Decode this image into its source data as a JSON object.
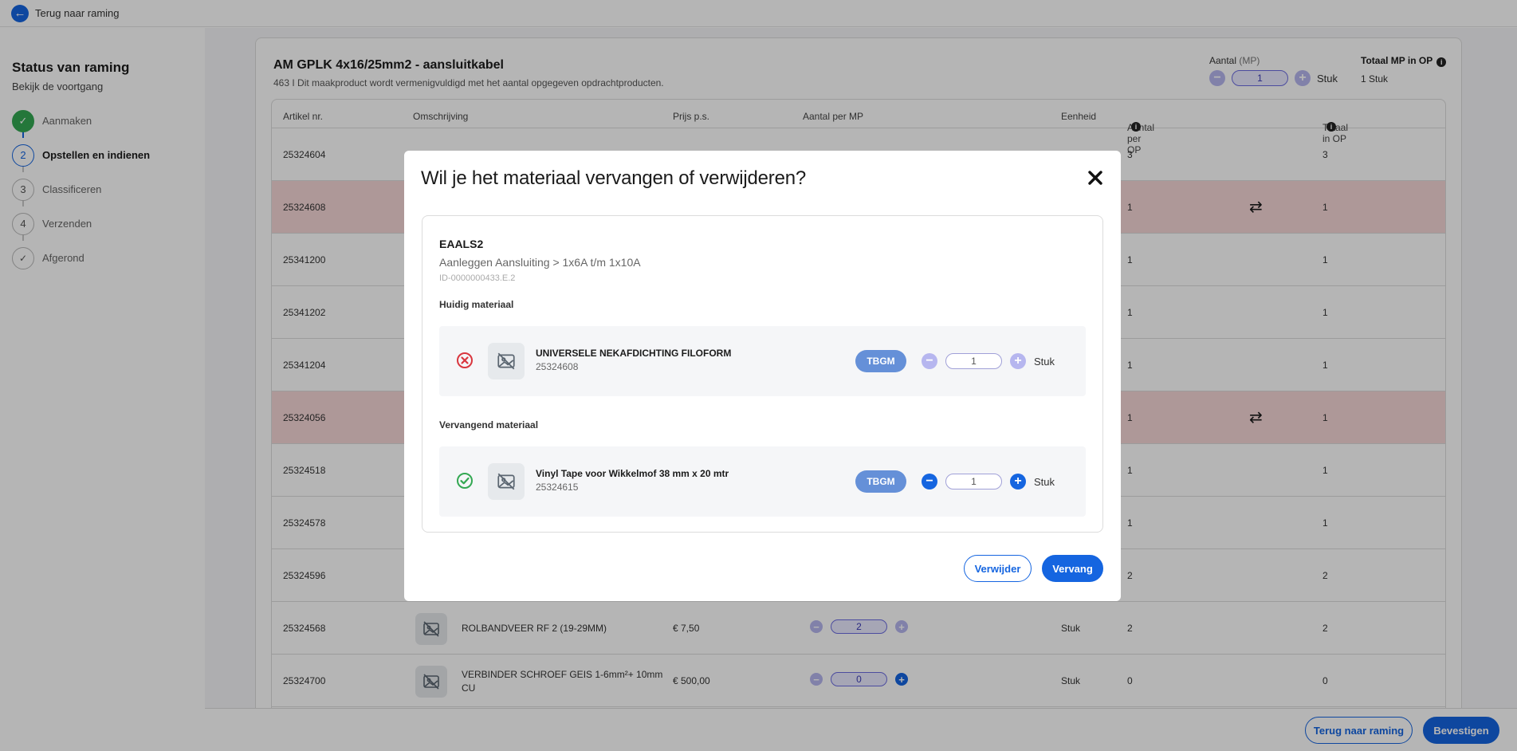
{
  "topbar": {
    "back_label": "Terug naar raming"
  },
  "sidebar": {
    "title": "Status van raming",
    "subtitle": "Bekijk de voortgang",
    "steps": [
      {
        "number": "",
        "label": "Aanmaken",
        "state": "done"
      },
      {
        "number": "2",
        "label": "Opstellen en indienen",
        "state": "active"
      },
      {
        "number": "3",
        "label": "Classificeren",
        "state": "todo"
      },
      {
        "number": "4",
        "label": "Verzenden",
        "state": "todo"
      },
      {
        "number": "",
        "label": "Afgerond",
        "state": "check"
      }
    ]
  },
  "card": {
    "title": "AM GPLK 4x16/25mm2 - aansluitkabel",
    "subtitle": "463  I  Dit maakproduct wordt vermenigvuldigd met het aantal opgegeven opdrachtproducten.",
    "qty_label": "Aantal",
    "qty_unit": "(MP)",
    "qty_value": "1",
    "qty_stuk": "Stuk",
    "total_label": "Totaal MP in OP",
    "total_value": "1 Stuk"
  },
  "table": {
    "headers": {
      "artikel": "Artikel nr.",
      "omschrijving": "Omschrijving",
      "prijs": "Prijs p.s.",
      "aantal_mp": "Aantal per MP",
      "eenheid": "Eenheid",
      "aantal_op": "Aantal per OP",
      "totaal_op": "Totaal in OP"
    },
    "rows": [
      {
        "artikel": "25324604",
        "aantal_op": "3",
        "totaal_op": "3",
        "red": false,
        "swap": false
      },
      {
        "artikel": "25324608",
        "aantal_op": "1",
        "totaal_op": "1",
        "red": true,
        "swap": true
      },
      {
        "artikel": "25341200",
        "aantal_op": "1",
        "totaal_op": "1",
        "red": false,
        "swap": false
      },
      {
        "artikel": "25341202",
        "aantal_op": "1",
        "totaal_op": "1",
        "red": false,
        "swap": false
      },
      {
        "artikel": "25341204",
        "aantal_op": "1",
        "totaal_op": "1",
        "red": false,
        "swap": false
      },
      {
        "artikel": "25324056",
        "aantal_op": "1",
        "totaal_op": "1",
        "red": true,
        "swap": true
      },
      {
        "artikel": "25324518",
        "aantal_op": "1",
        "totaal_op": "1",
        "red": false,
        "swap": false
      },
      {
        "artikel": "25324578",
        "aantal_op": "1",
        "totaal_op": "1",
        "red": false,
        "swap": false
      },
      {
        "artikel": "25324596",
        "aantal_op": "2",
        "totaal_op": "2",
        "red": false,
        "swap": false
      },
      {
        "artikel": "25324568",
        "omschrijving": "ROLBANDVEER RF 2 (19-29MM)",
        "prijs": "€ 7,50",
        "qty": "2",
        "eenheid": "Stuk",
        "aantal_op": "2",
        "totaal_op": "2",
        "red": false,
        "swap": false
      },
      {
        "artikel": "25324700",
        "omschrijving_1": "VERBINDER SCHROEF GEIS 1-6mm²+ 10mm",
        "omschrijving_2": "CU",
        "prijs": "€ 500,00",
        "qty": "0",
        "eenheid": "Stuk",
        "aantal_op": "0",
        "totaal_op": "0",
        "red": false,
        "swap": false
      }
    ]
  },
  "footer": {
    "back_button": "Terug naar raming",
    "confirm_button": "Bevestigen"
  },
  "modal": {
    "title": "Wil je het materiaal vervangen of verwijderen?",
    "code": "EAALS2",
    "path": "Aanleggen Aansluiting > 1x6A t/m 1x10A",
    "id": "ID-0000000433.E.2",
    "current_label": "Huidig materiaal",
    "current": {
      "name": "UNIVERSELE NEKAFDICHTING FILOFORM",
      "artikel": "25324608",
      "badge": "TBGM",
      "qty": "1",
      "unit": "Stuk"
    },
    "replacement_label": "Vervangend materiaal",
    "replacement": {
      "name": "Vinyl Tape voor Wikkelmof 38 mm x 20 mtr",
      "artikel": "25324615",
      "badge": "TBGM",
      "qty": "1",
      "unit": "Stuk"
    },
    "delete_button": "Verwijder",
    "replace_button": "Vervang"
  },
  "colors": {
    "primary": "#1565e0",
    "success": "#33a852",
    "danger": "#d9363e",
    "row_highlight": "#f5d6d6",
    "badge": "#6590d8"
  },
  "icons": {
    "back": "arrow-left-icon",
    "close": "close-icon",
    "swap": "swap-icon",
    "info": "info-icon",
    "no_image": "no-image-icon",
    "remove": "remove-circle-icon",
    "ok": "check-circle-icon"
  }
}
